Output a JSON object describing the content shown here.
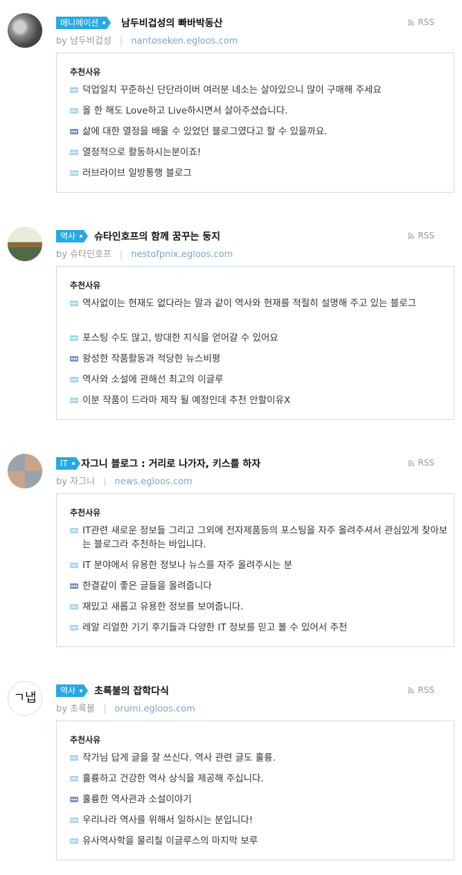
{
  "rss_label": "RSS",
  "by_label": "by",
  "reason_header": "추천사유",
  "blogs": [
    {
      "category": "애니메이션",
      "title": "남두비겁성의 빠바박동산",
      "author": "남두비겁성",
      "url": "nantoseken.egloos.com",
      "reasons": [
        "덕업일치 꾸준하신 단단라이버 여러분 네소는 살아있으니 많이 구매해 주세요",
        "올 한 해도 Love하고 Live하시면서 살아주셨습니다.",
        "삶에 대한 열정을 배울 수 있었던 블로그였다고 할 수 있을까요.",
        "열정적으로 활동하시는분이죠!",
        "러브라이브 일방통행 블로그"
      ]
    },
    {
      "category": "역사",
      "title": "슈타인호프의 함께 꿈꾸는 둥지",
      "author": "슈타인호프",
      "url": "nestofpnix.egloos.com",
      "reasons": [
        "역사없이는 현재도 없다라는 말과 같이 역사와 현재를 적절히 설명해 주고 있는 블로그",
        "포스팅 수도 많고, 방대한 지식을 얻어갈 수 있어요",
        "왕성한 작품활동과 적당한 뉴스비평",
        "역사와 소설에 관해선 최고의 이글루",
        "이분 작품이 드라마 제작 될 예정인데 추천 안할이유X"
      ]
    },
    {
      "category": "IT",
      "title": "자그니 블로그 : 거리로 나가자, 키스를 하자",
      "author": "자그니",
      "url": "news.egloos.com",
      "reasons": [
        "IT관련 새로운 정보들 그리고 그외에 전자제품등의 포스팅을 자주 올려주셔서 관심있게 찾아보는 블로그라 추천하는 바입니다.",
        "IT 분야에서 유용한 정보나 뉴스를 자주 올려주시는 분",
        "한결같이 좋은 글들을 올려줍니다",
        "재밌고 새롭고 유용한 정보를 보여줍니다.",
        "레알 리얼한 기기 후기들과 다양한 IT 정보를 믿고 볼 수 있어서 추천"
      ]
    },
    {
      "category": "역사",
      "title": "초록불의 잡학다식",
      "author": "초록불",
      "url": "orumi.egloos.com",
      "avatar_text": "ㄱ냅",
      "reasons": [
        "작가님 답게 글을 잘 쓰신다. 역사 관련 글도 훌륭.",
        "훌륭하고 건강한 역사 상식을 제공해 주십니다.",
        "훌륭한 역사관과 소설이야기",
        "우리나라 역사를 위해서 일하시는 분입니다!",
        "유사역사학을 물리칠 이글루스의 마지막 보루"
      ]
    }
  ]
}
